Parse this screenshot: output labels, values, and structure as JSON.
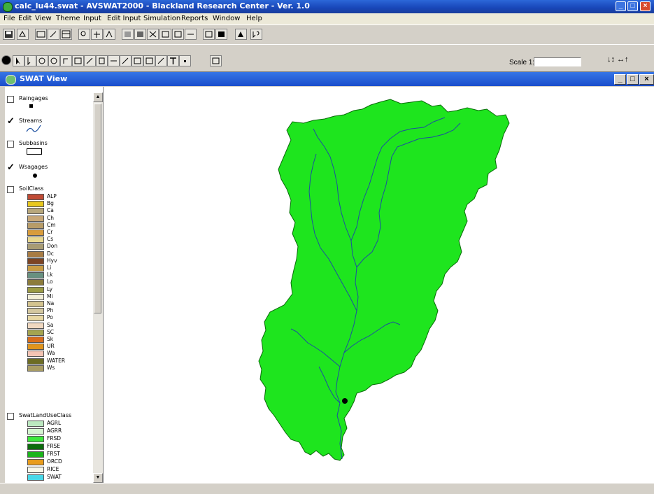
{
  "app": {
    "title": "calc_lu44.swat - AVSWAT2000 - Blackland Research Center - Ver. 1.0"
  },
  "menu": [
    "File",
    "Edit",
    "View",
    "Theme",
    "Input",
    "Edit Input",
    "Simulation",
    "Reports",
    "Window",
    "Help"
  ],
  "toolbar": {
    "scale_label": "Scale 1:",
    "scale_value": "",
    "coordinate_readout": "↓↕ ↔↑"
  },
  "view": {
    "title": "SWAT View",
    "minimize": "_",
    "maximize": "□",
    "close": "×"
  },
  "layers": [
    {
      "name": "Raingages",
      "checked": false
    },
    {
      "name": "Streams",
      "checked": true
    },
    {
      "name": "Subbasins",
      "checked": false
    },
    {
      "name": "Wsagages",
      "checked": true
    },
    {
      "name": "SoilClass",
      "checked": false
    },
    {
      "name": "SwatLandUseClass",
      "checked": false
    }
  ],
  "soil_classes": [
    {
      "code": "ALP",
      "color": "#c04a34"
    },
    {
      "code": "Bg",
      "color": "#e8c81c"
    },
    {
      "code": "Ca",
      "color": "#b8a87c"
    },
    {
      "code": "Ch",
      "color": "#c8a878"
    },
    {
      "code": "Cm",
      "color": "#b89c68"
    },
    {
      "code": "Cr",
      "color": "#d89c3c"
    },
    {
      "code": "Cs",
      "color": "#e8d890"
    },
    {
      "code": "Don",
      "color": "#a89c74"
    },
    {
      "code": "Dc",
      "color": "#a87c44"
    },
    {
      "code": "Hyv",
      "color": "#7c4424"
    },
    {
      "code": "Li",
      "color": "#c89c44"
    },
    {
      "code": "Lk",
      "color": "#689080"
    },
    {
      "code": "Lo",
      "color": "#8c7c3c"
    },
    {
      "code": "Ly",
      "color": "#9c9c44"
    },
    {
      "code": "Mi",
      "color": "#f4f0d8"
    },
    {
      "code": "Na",
      "color": "#d4c490"
    },
    {
      "code": "Ph",
      "color": "#d4c8a0"
    },
    {
      "code": "Po",
      "color": "#e8d8a4"
    },
    {
      "code": "Sa",
      "color": "#f0d8c0"
    },
    {
      "code": "SC",
      "color": "#a4a450"
    },
    {
      "code": "Sk",
      "color": "#d86c1c"
    },
    {
      "code": "UR",
      "color": "#e0941c"
    },
    {
      "code": "Wa",
      "color": "#f4c4b4"
    },
    {
      "code": "WATER",
      "color": "#6c6c24"
    },
    {
      "code": "Ws",
      "color": "#a89c64"
    }
  ],
  "landuse_classes": [
    {
      "code": "AGRL",
      "color": "#bce8c0"
    },
    {
      "code": "AGRR",
      "color": "#d4f4d0"
    },
    {
      "code": "FRSD",
      "color": "#3ce83c"
    },
    {
      "code": "FRSE",
      "color": "#0c6c0c"
    },
    {
      "code": "FRST",
      "color": "#1cb41c"
    },
    {
      "code": "ORCD",
      "color": "#e89c1c"
    },
    {
      "code": "RICE",
      "color": "#f8f8e8"
    },
    {
      "code": "SWAT",
      "color": "#48d8e8"
    }
  ],
  "colors": {
    "watershed_fill": "#1ee51e",
    "stream": "#1c4fa0",
    "title_bar": "#1846b8"
  }
}
